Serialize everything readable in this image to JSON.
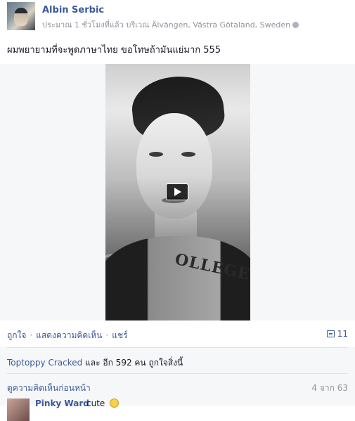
{
  "post": {
    "author": "Albin Serbic",
    "meta": "ประมาณ 1 ชั่วโมงที่แล้ว บริเวณ Älvängen, Västra Götaland, Sweden",
    "message": "ผมพยายามที่จะพูดภาษาไทย ขอโทษถ้ามันแย่มาก 555"
  },
  "actions": {
    "like": "ถูกใจ",
    "comment": "แสดงความคิดเห็น",
    "share": "แชร์",
    "separator": "·",
    "share_count": "11"
  },
  "likes": {
    "name": "Toptoppy Cracked",
    "rest": " และ อีก 592 คน ถูกใจสิ่งนี้"
  },
  "comments": {
    "view_previous": "ดูความคิดเห็นก่อนหน้า",
    "count": "4 จาก 63",
    "items": [
      {
        "author": "Pinky Ward",
        "text": "cute"
      }
    ]
  },
  "video": {
    "shirt_text": "OLLEGE"
  }
}
